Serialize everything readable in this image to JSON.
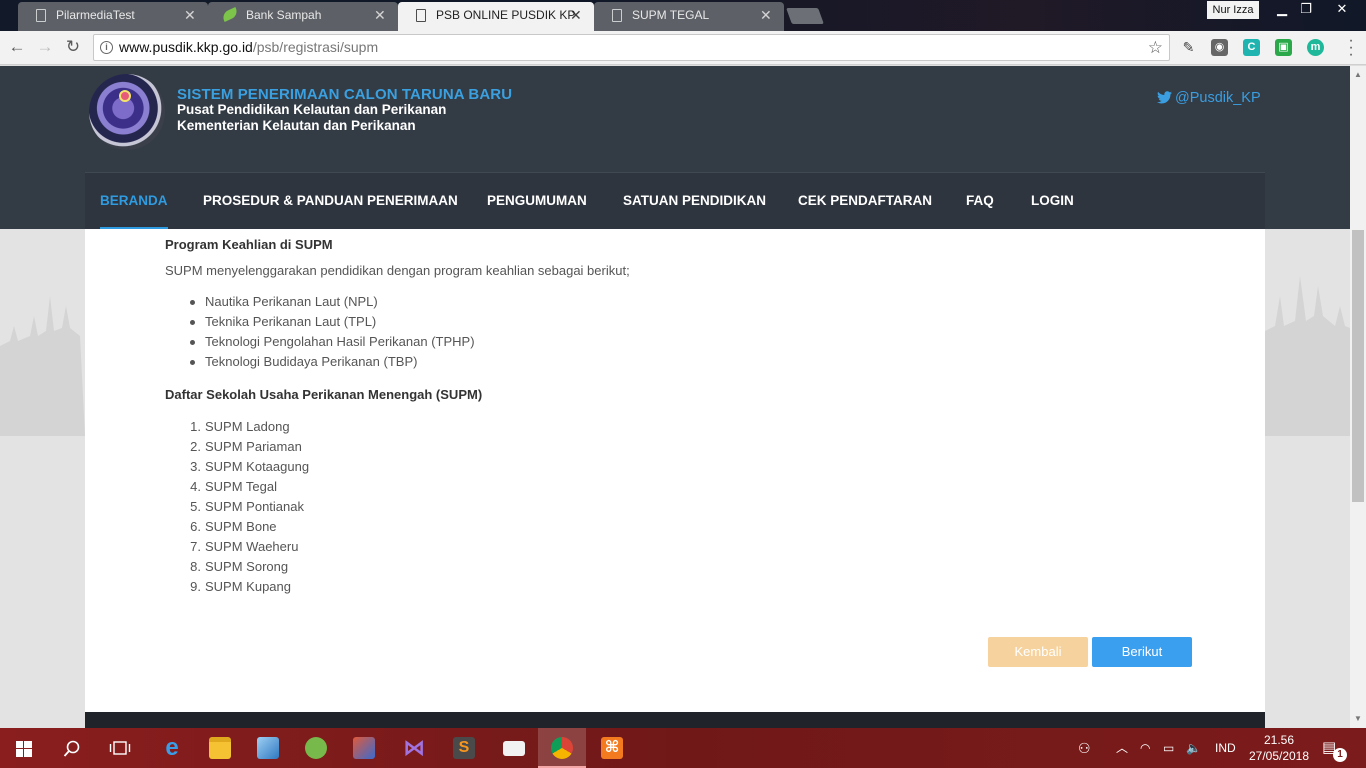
{
  "browser": {
    "tabs": [
      {
        "title": "PilarmediaTest",
        "icon": "document-icon"
      },
      {
        "title": "Bank Sampah",
        "icon": "leaf-icon"
      },
      {
        "title": "PSB ONLINE PUSDIK KP",
        "icon": "document-icon",
        "active": true
      },
      {
        "title": "SUPM TEGAL",
        "icon": "document-icon"
      }
    ],
    "profile_name": "Nur Izza",
    "url_host": "www.pusdik.kkp.go.id",
    "url_path": "/psb/registrasi/supm"
  },
  "site": {
    "title": "SISTEM PENERIMAAN CALON TARUNA BARU",
    "subtitle1": "Pusat Pendidikan Kelautan dan Perikanan",
    "subtitle2": "Kementerian Kelautan dan Perikanan",
    "twitter": "@Pusdik_KP"
  },
  "nav": [
    {
      "label": "BERANDA",
      "active": true
    },
    {
      "label": "PROSEDUR & PANDUAN PENERIMAAN"
    },
    {
      "label": "PENGUMUMAN"
    },
    {
      "label": "SATUAN PENDIDIKAN"
    },
    {
      "label": "CEK PENDAFTARAN"
    },
    {
      "label": "FAQ"
    },
    {
      "label": "LOGIN"
    }
  ],
  "content": {
    "section1_title": "Program Keahlian di SUPM",
    "section1_intro": "SUPM menyelenggarakan pendidikan dengan program keahlian sebagai berikut;",
    "programs": [
      "Nautika Perikanan Laut (NPL)",
      "Teknika Perikanan Laut (TPL)",
      "Teknologi Pengolahan Hasil Perikanan (TPHP)",
      "Teknologi Budidaya Perikanan (TBP)"
    ],
    "section2_title": "Daftar Sekolah Usaha Perikanan Menengah (SUPM)",
    "schools": [
      {
        "num": "1.",
        "name": "SUPM Ladong"
      },
      {
        "num": "2.",
        "name": "SUPM Pariaman"
      },
      {
        "num": "3.",
        "name": "SUPM Kotaagung"
      },
      {
        "num": "4.",
        "name": "SUPM Tegal"
      },
      {
        "num": "5.",
        "name": "SUPM Pontianak"
      },
      {
        "num": "6.",
        "name": "SUPM Bone"
      },
      {
        "num": "7.",
        "name": "SUPM Waeheru"
      },
      {
        "num": "8.",
        "name": "SUPM Sorong"
      },
      {
        "num": "9.",
        "name": "SUPM Kupang"
      }
    ],
    "back_label": "Kembali",
    "next_label": "Berikut"
  },
  "taskbar": {
    "language": "IND",
    "time": "21.56",
    "date": "27/05/2018",
    "notification_count": "1"
  },
  "colors": {
    "accent": "#2f9be0",
    "header_bg": "#333b45",
    "back_button": "#f6d39e",
    "next_button": "#3b9ff0",
    "taskbar": "#7a1c1c"
  }
}
